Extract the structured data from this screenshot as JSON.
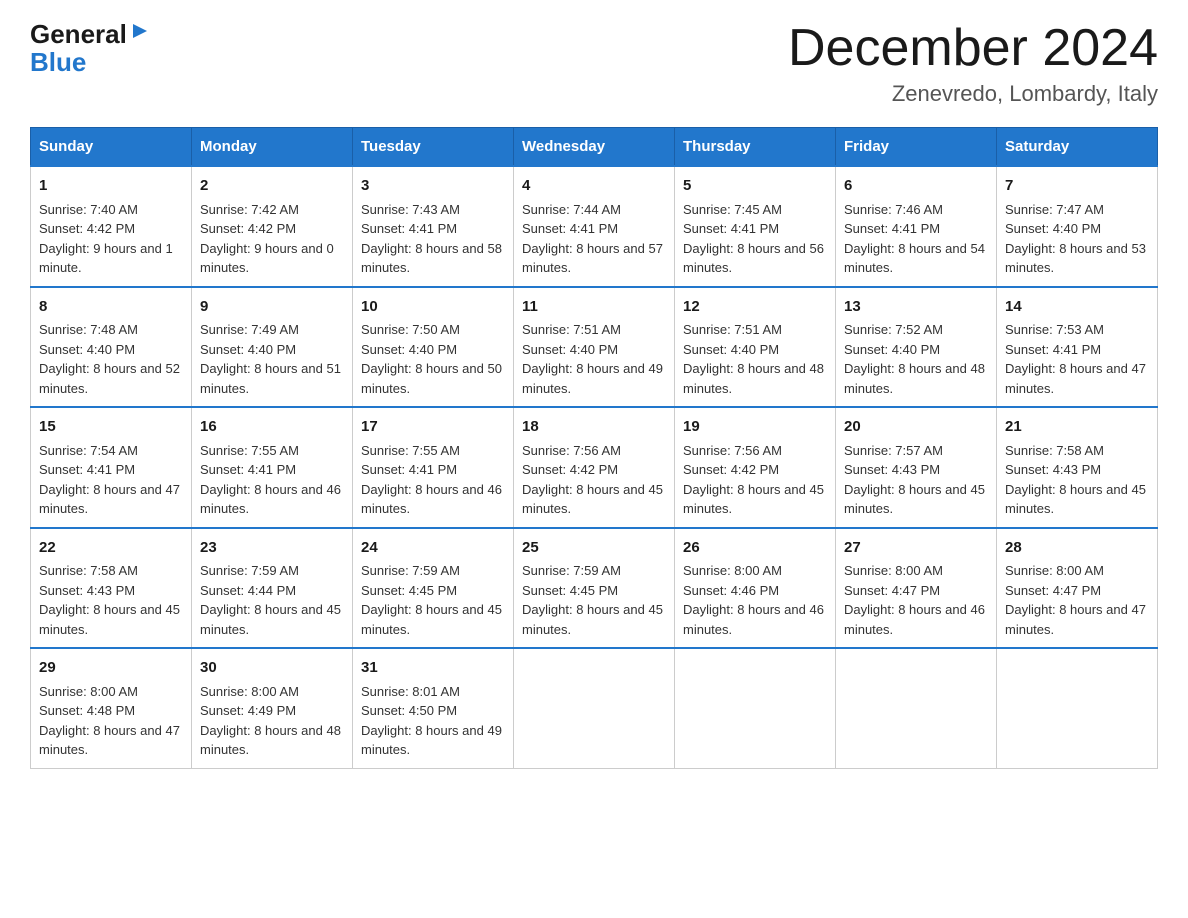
{
  "logo": {
    "general": "General",
    "blue": "Blue"
  },
  "title": "December 2024",
  "subtitle": "Zenevredo, Lombardy, Italy",
  "headers": [
    "Sunday",
    "Monday",
    "Tuesday",
    "Wednesday",
    "Thursday",
    "Friday",
    "Saturday"
  ],
  "weeks": [
    [
      {
        "day": "1",
        "sunrise": "7:40 AM",
        "sunset": "4:42 PM",
        "daylight": "9 hours and 1 minute."
      },
      {
        "day": "2",
        "sunrise": "7:42 AM",
        "sunset": "4:42 PM",
        "daylight": "9 hours and 0 minutes."
      },
      {
        "day": "3",
        "sunrise": "7:43 AM",
        "sunset": "4:41 PM",
        "daylight": "8 hours and 58 minutes."
      },
      {
        "day": "4",
        "sunrise": "7:44 AM",
        "sunset": "4:41 PM",
        "daylight": "8 hours and 57 minutes."
      },
      {
        "day": "5",
        "sunrise": "7:45 AM",
        "sunset": "4:41 PM",
        "daylight": "8 hours and 56 minutes."
      },
      {
        "day": "6",
        "sunrise": "7:46 AM",
        "sunset": "4:41 PM",
        "daylight": "8 hours and 54 minutes."
      },
      {
        "day": "7",
        "sunrise": "7:47 AM",
        "sunset": "4:40 PM",
        "daylight": "8 hours and 53 minutes."
      }
    ],
    [
      {
        "day": "8",
        "sunrise": "7:48 AM",
        "sunset": "4:40 PM",
        "daylight": "8 hours and 52 minutes."
      },
      {
        "day": "9",
        "sunrise": "7:49 AM",
        "sunset": "4:40 PM",
        "daylight": "8 hours and 51 minutes."
      },
      {
        "day": "10",
        "sunrise": "7:50 AM",
        "sunset": "4:40 PM",
        "daylight": "8 hours and 50 minutes."
      },
      {
        "day": "11",
        "sunrise": "7:51 AM",
        "sunset": "4:40 PM",
        "daylight": "8 hours and 49 minutes."
      },
      {
        "day": "12",
        "sunrise": "7:51 AM",
        "sunset": "4:40 PM",
        "daylight": "8 hours and 48 minutes."
      },
      {
        "day": "13",
        "sunrise": "7:52 AM",
        "sunset": "4:40 PM",
        "daylight": "8 hours and 48 minutes."
      },
      {
        "day": "14",
        "sunrise": "7:53 AM",
        "sunset": "4:41 PM",
        "daylight": "8 hours and 47 minutes."
      }
    ],
    [
      {
        "day": "15",
        "sunrise": "7:54 AM",
        "sunset": "4:41 PM",
        "daylight": "8 hours and 47 minutes."
      },
      {
        "day": "16",
        "sunrise": "7:55 AM",
        "sunset": "4:41 PM",
        "daylight": "8 hours and 46 minutes."
      },
      {
        "day": "17",
        "sunrise": "7:55 AM",
        "sunset": "4:41 PM",
        "daylight": "8 hours and 46 minutes."
      },
      {
        "day": "18",
        "sunrise": "7:56 AM",
        "sunset": "4:42 PM",
        "daylight": "8 hours and 45 minutes."
      },
      {
        "day": "19",
        "sunrise": "7:56 AM",
        "sunset": "4:42 PM",
        "daylight": "8 hours and 45 minutes."
      },
      {
        "day": "20",
        "sunrise": "7:57 AM",
        "sunset": "4:43 PM",
        "daylight": "8 hours and 45 minutes."
      },
      {
        "day": "21",
        "sunrise": "7:58 AM",
        "sunset": "4:43 PM",
        "daylight": "8 hours and 45 minutes."
      }
    ],
    [
      {
        "day": "22",
        "sunrise": "7:58 AM",
        "sunset": "4:43 PM",
        "daylight": "8 hours and 45 minutes."
      },
      {
        "day": "23",
        "sunrise": "7:59 AM",
        "sunset": "4:44 PM",
        "daylight": "8 hours and 45 minutes."
      },
      {
        "day": "24",
        "sunrise": "7:59 AM",
        "sunset": "4:45 PM",
        "daylight": "8 hours and 45 minutes."
      },
      {
        "day": "25",
        "sunrise": "7:59 AM",
        "sunset": "4:45 PM",
        "daylight": "8 hours and 45 minutes."
      },
      {
        "day": "26",
        "sunrise": "8:00 AM",
        "sunset": "4:46 PM",
        "daylight": "8 hours and 46 minutes."
      },
      {
        "day": "27",
        "sunrise": "8:00 AM",
        "sunset": "4:47 PM",
        "daylight": "8 hours and 46 minutes."
      },
      {
        "day": "28",
        "sunrise": "8:00 AM",
        "sunset": "4:47 PM",
        "daylight": "8 hours and 47 minutes."
      }
    ],
    [
      {
        "day": "29",
        "sunrise": "8:00 AM",
        "sunset": "4:48 PM",
        "daylight": "8 hours and 47 minutes."
      },
      {
        "day": "30",
        "sunrise": "8:00 AM",
        "sunset": "4:49 PM",
        "daylight": "8 hours and 48 minutes."
      },
      {
        "day": "31",
        "sunrise": "8:01 AM",
        "sunset": "4:50 PM",
        "daylight": "8 hours and 49 minutes."
      },
      null,
      null,
      null,
      null
    ]
  ],
  "labels": {
    "sunrise": "Sunrise:",
    "sunset": "Sunset:",
    "daylight": "Daylight:"
  }
}
